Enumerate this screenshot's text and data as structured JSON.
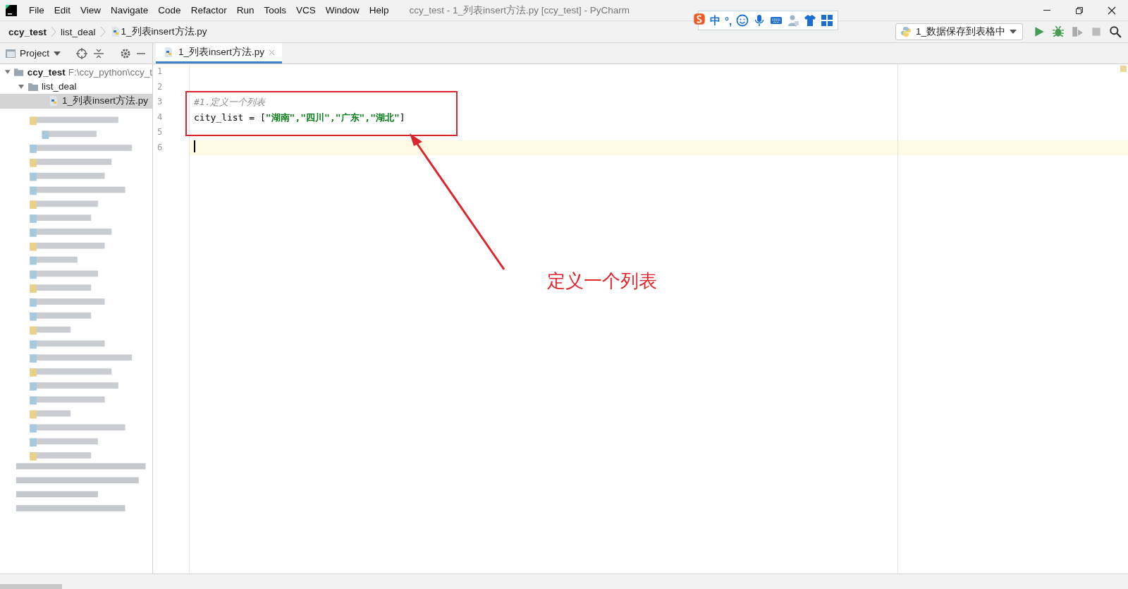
{
  "window": {
    "title": "ccy_test - 1_列表insert方法.py [ccy_test] - PyCharm"
  },
  "menu": [
    "File",
    "Edit",
    "View",
    "Navigate",
    "Code",
    "Refactor",
    "Run",
    "Tools",
    "VCS",
    "Window",
    "Help"
  ],
  "breadcrumbs": [
    "ccy_test",
    "list_deal",
    "1_列表insert方法.py"
  ],
  "ime_toolbar": {
    "mode": "中",
    "punctuation": "°,"
  },
  "run_config": {
    "label": "1_数据保存到表格中"
  },
  "tool_window": {
    "title": "Project"
  },
  "editor_tabs": [
    {
      "label": "1_列表insert方法.py",
      "selected": true
    }
  ],
  "project_tree": [
    {
      "kind": "folder",
      "label": "ccy_test",
      "path": "F:\\ccy_python\\ccy_t",
      "expanded": true,
      "children": [
        {
          "kind": "folder",
          "label": "list_deal",
          "expanded": true,
          "children": [
            {
              "kind": "file",
              "label": "1_列表insert方法.py",
              "selected": true
            }
          ]
        }
      ]
    }
  ],
  "editor": {
    "lines": [
      {
        "number": "1",
        "current": false
      },
      {
        "number": "2",
        "current": false
      },
      {
        "number": "3",
        "current": false,
        "tokens": [
          {
            "kind": "comment",
            "text": "#1.定义一个列表"
          }
        ]
      },
      {
        "number": "4",
        "current": false,
        "tokens": [
          {
            "kind": "plain",
            "text": "city_list = ["
          },
          {
            "kind": "string",
            "text": "\"湖南\",\"四川\",\"广东\",\"湖北\""
          },
          {
            "kind": "plain",
            "text": "]"
          }
        ]
      },
      {
        "number": "5",
        "current": false
      },
      {
        "number": "6",
        "current": true
      }
    ]
  },
  "annotation": {
    "text": "定义一个列表"
  }
}
